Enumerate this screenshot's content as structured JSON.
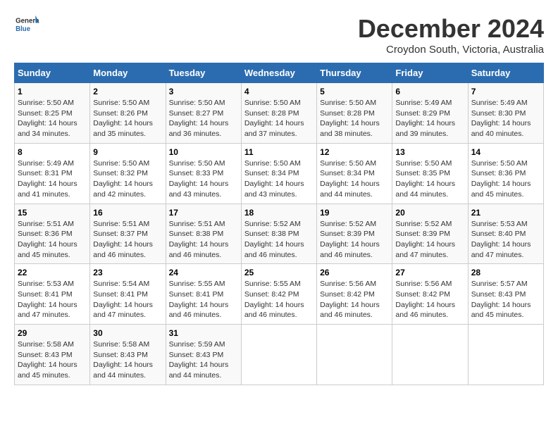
{
  "header": {
    "logo_line1": "General",
    "logo_line2": "Blue",
    "month": "December 2024",
    "location": "Croydon South, Victoria, Australia"
  },
  "days_of_week": [
    "Sunday",
    "Monday",
    "Tuesday",
    "Wednesday",
    "Thursday",
    "Friday",
    "Saturday"
  ],
  "weeks": [
    [
      {
        "day": "1",
        "sunrise": "5:50 AM",
        "sunset": "8:25 PM",
        "daylight": "14 hours and 34 minutes."
      },
      {
        "day": "2",
        "sunrise": "5:50 AM",
        "sunset": "8:26 PM",
        "daylight": "14 hours and 35 minutes."
      },
      {
        "day": "3",
        "sunrise": "5:50 AM",
        "sunset": "8:27 PM",
        "daylight": "14 hours and 36 minutes."
      },
      {
        "day": "4",
        "sunrise": "5:50 AM",
        "sunset": "8:28 PM",
        "daylight": "14 hours and 37 minutes."
      },
      {
        "day": "5",
        "sunrise": "5:50 AM",
        "sunset": "8:28 PM",
        "daylight": "14 hours and 38 minutes."
      },
      {
        "day": "6",
        "sunrise": "5:49 AM",
        "sunset": "8:29 PM",
        "daylight": "14 hours and 39 minutes."
      },
      {
        "day": "7",
        "sunrise": "5:49 AM",
        "sunset": "8:30 PM",
        "daylight": "14 hours and 40 minutes."
      }
    ],
    [
      {
        "day": "8",
        "sunrise": "5:49 AM",
        "sunset": "8:31 PM",
        "daylight": "14 hours and 41 minutes."
      },
      {
        "day": "9",
        "sunrise": "5:50 AM",
        "sunset": "8:32 PM",
        "daylight": "14 hours and 42 minutes."
      },
      {
        "day": "10",
        "sunrise": "5:50 AM",
        "sunset": "8:33 PM",
        "daylight": "14 hours and 43 minutes."
      },
      {
        "day": "11",
        "sunrise": "5:50 AM",
        "sunset": "8:34 PM",
        "daylight": "14 hours and 43 minutes."
      },
      {
        "day": "12",
        "sunrise": "5:50 AM",
        "sunset": "8:34 PM",
        "daylight": "14 hours and 44 minutes."
      },
      {
        "day": "13",
        "sunrise": "5:50 AM",
        "sunset": "8:35 PM",
        "daylight": "14 hours and 44 minutes."
      },
      {
        "day": "14",
        "sunrise": "5:50 AM",
        "sunset": "8:36 PM",
        "daylight": "14 hours and 45 minutes."
      }
    ],
    [
      {
        "day": "15",
        "sunrise": "5:51 AM",
        "sunset": "8:36 PM",
        "daylight": "14 hours and 45 minutes."
      },
      {
        "day": "16",
        "sunrise": "5:51 AM",
        "sunset": "8:37 PM",
        "daylight": "14 hours and 46 minutes."
      },
      {
        "day": "17",
        "sunrise": "5:51 AM",
        "sunset": "8:38 PM",
        "daylight": "14 hours and 46 minutes."
      },
      {
        "day": "18",
        "sunrise": "5:52 AM",
        "sunset": "8:38 PM",
        "daylight": "14 hours and 46 minutes."
      },
      {
        "day": "19",
        "sunrise": "5:52 AM",
        "sunset": "8:39 PM",
        "daylight": "14 hours and 46 minutes."
      },
      {
        "day": "20",
        "sunrise": "5:52 AM",
        "sunset": "8:39 PM",
        "daylight": "14 hours and 47 minutes."
      },
      {
        "day": "21",
        "sunrise": "5:53 AM",
        "sunset": "8:40 PM",
        "daylight": "14 hours and 47 minutes."
      }
    ],
    [
      {
        "day": "22",
        "sunrise": "5:53 AM",
        "sunset": "8:41 PM",
        "daylight": "14 hours and 47 minutes."
      },
      {
        "day": "23",
        "sunrise": "5:54 AM",
        "sunset": "8:41 PM",
        "daylight": "14 hours and 47 minutes."
      },
      {
        "day": "24",
        "sunrise": "5:55 AM",
        "sunset": "8:41 PM",
        "daylight": "14 hours and 46 minutes."
      },
      {
        "day": "25",
        "sunrise": "5:55 AM",
        "sunset": "8:42 PM",
        "daylight": "14 hours and 46 minutes."
      },
      {
        "day": "26",
        "sunrise": "5:56 AM",
        "sunset": "8:42 PM",
        "daylight": "14 hours and 46 minutes."
      },
      {
        "day": "27",
        "sunrise": "5:56 AM",
        "sunset": "8:42 PM",
        "daylight": "14 hours and 46 minutes."
      },
      {
        "day": "28",
        "sunrise": "5:57 AM",
        "sunset": "8:43 PM",
        "daylight": "14 hours and 45 minutes."
      }
    ],
    [
      {
        "day": "29",
        "sunrise": "5:58 AM",
        "sunset": "8:43 PM",
        "daylight": "14 hours and 45 minutes."
      },
      {
        "day": "30",
        "sunrise": "5:58 AM",
        "sunset": "8:43 PM",
        "daylight": "14 hours and 44 minutes."
      },
      {
        "day": "31",
        "sunrise": "5:59 AM",
        "sunset": "8:43 PM",
        "daylight": "14 hours and 44 minutes."
      },
      null,
      null,
      null,
      null
    ]
  ]
}
